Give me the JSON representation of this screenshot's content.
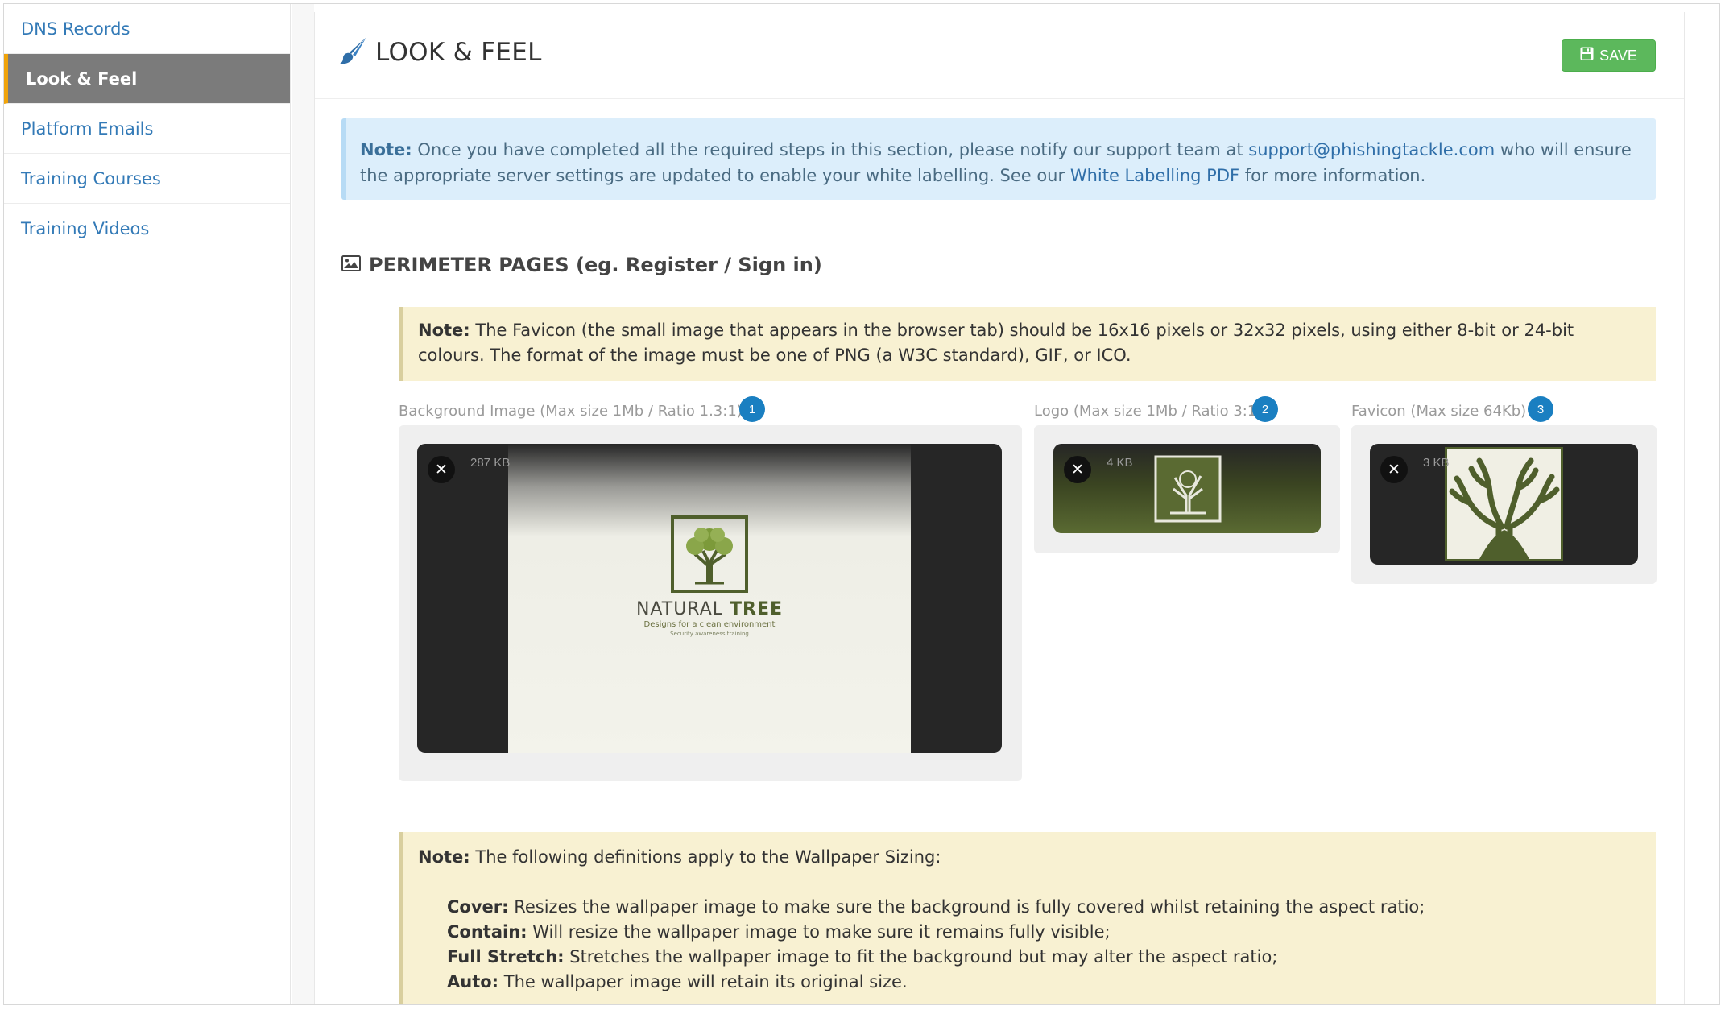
{
  "sidebar": {
    "items": [
      {
        "label": "DNS Records"
      },
      {
        "label": "Look & Feel"
      },
      {
        "label": "Platform Emails"
      },
      {
        "label": "Training Courses"
      },
      {
        "label": "Training Videos"
      }
    ]
  },
  "header": {
    "title": "LOOK & FEEL",
    "title_icon": "paint-brush-icon",
    "save_label": "SAVE",
    "save_icon": "floppy-disk-icon"
  },
  "info_note": {
    "label": "Note:",
    "text1": " Once you have completed all the required steps in this section, please notify our support team at ",
    "email": "support@phishingtackle.com",
    "text2": " who will ensure the appropriate server settings are updated to enable your white labelling. See our ",
    "pdf_link": "White Labelling PDF",
    "text3": " for more information."
  },
  "section": {
    "title": "PERIMETER PAGES (eg. Register / Sign in)",
    "icon": "image-icon"
  },
  "favicon_note": {
    "label": "Note:",
    "text": " The Favicon (the small image that appears in the browser tab) should be 16x16 pixels or 32x32 pixels, using either 8-bit or 24-bit colours. The format of the image must be one of PNG (a W3C standard), GIF, or ICO."
  },
  "uploads": [
    {
      "label": "Background Image (Max size 1Mb / Ratio 1.3:1)",
      "badge": "1",
      "size": "287 KB",
      "brand": "NATURAL",
      "brand_bold": "TREE",
      "tagline": "Designs for a clean environment",
      "subtag": "Security awareness training"
    },
    {
      "label": "Logo (Max size 1Mb / Ratio 3:1)",
      "badge": "2",
      "size": "4 KB"
    },
    {
      "label": "Favicon (Max size 64Kb)",
      "badge": "3",
      "size": "3 KB"
    }
  ],
  "remove_glyph": "✕",
  "sizing_note": {
    "label": "Note:",
    "intro": " The following definitions apply to the Wallpaper Sizing:",
    "defs": [
      {
        "term": "Cover:",
        "desc": " Resizes the wallpaper image to make sure the background is fully covered whilst retaining the aspect ratio;"
      },
      {
        "term": "Contain:",
        "desc": " Will resize the wallpaper image to make sure it remains fully visible;"
      },
      {
        "term": "Full Stretch:",
        "desc": " Stretches the wallpaper image to fit the background but may alter the aspect ratio;"
      },
      {
        "term": "Auto:",
        "desc": " The wallpaper image will retain its original size."
      }
    ]
  },
  "colors": {
    "link": "#337ab7",
    "active_nav_bg": "#7b7b7b",
    "active_nav_accent": "#f0a30a",
    "save_green": "#5cb85c",
    "badge_blue": "#1a7fc1",
    "tree_green": "#4f5f2c"
  }
}
